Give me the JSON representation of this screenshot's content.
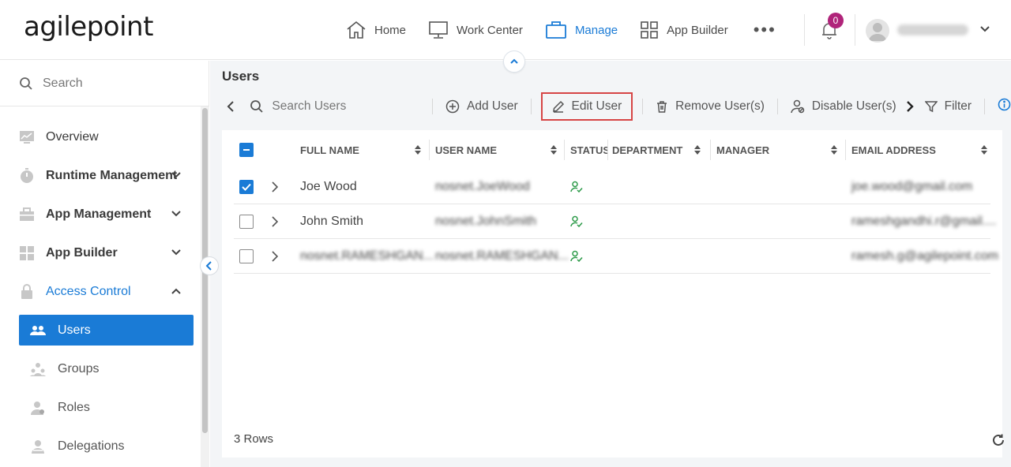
{
  "brand": {
    "logo_text": "agilepoint"
  },
  "nav": [
    {
      "label": "Home",
      "icon": "home-icon"
    },
    {
      "label": "Work Center",
      "icon": "monitor-icon"
    },
    {
      "label": "Manage",
      "icon": "briefcase-icon",
      "active": true
    },
    {
      "label": "App Builder",
      "icon": "grid-icon"
    }
  ],
  "notifications": {
    "count": "0"
  },
  "colors": {
    "accent": "#1a7bd6",
    "badge": "#b0247a",
    "highlight_border": "#d64545",
    "status_green": "#2e9b4a"
  },
  "sidebar": {
    "search_placeholder": "Search",
    "items": [
      {
        "label": "Overview",
        "icon": "overview-icon"
      },
      {
        "label": "Runtime Management",
        "icon": "stopwatch-icon",
        "expandable": true
      },
      {
        "label": "App Management",
        "icon": "toolbox-icon",
        "expandable": true
      },
      {
        "label": "App Builder",
        "icon": "app-builder-icon",
        "expandable": true
      },
      {
        "label": "Access Control",
        "icon": "lock-icon",
        "expanded": true
      }
    ],
    "sub_items": [
      {
        "label": "Users",
        "icon": "users-icon",
        "active": true
      },
      {
        "label": "Groups",
        "icon": "groups-icon"
      },
      {
        "label": "Roles",
        "icon": "roles-icon"
      },
      {
        "label": "Delegations",
        "icon": "delegations-icon"
      }
    ]
  },
  "main": {
    "title": "Users",
    "search_placeholder": "Search Users",
    "toolbar": {
      "add": "Add User",
      "edit": "Edit User",
      "remove": "Remove User(s)",
      "disable": "Disable User(s)",
      "filter": "Filter"
    },
    "columns": [
      "FULL NAME",
      "USER NAME",
      "STATUS",
      "DEPARTMENT",
      "MANAGER",
      "EMAIL ADDRESS"
    ],
    "rows": [
      {
        "full_name": "Joe Wood",
        "user_name": "nosnet.JoeWood",
        "email": "joe.wood@gmail.com",
        "checked": true
      },
      {
        "full_name": "John Smith",
        "user_name": "nosnet.JohnSmith",
        "email": "rameshgandhi.r@gmail....",
        "checked": false
      },
      {
        "full_name": "nosnet.RAMESHGAN...",
        "user_name": "nosnet.RAMESHGAN...",
        "email": "ramesh.g@agilepoint.com",
        "checked": false
      }
    ],
    "rows_count": "3 Rows"
  }
}
